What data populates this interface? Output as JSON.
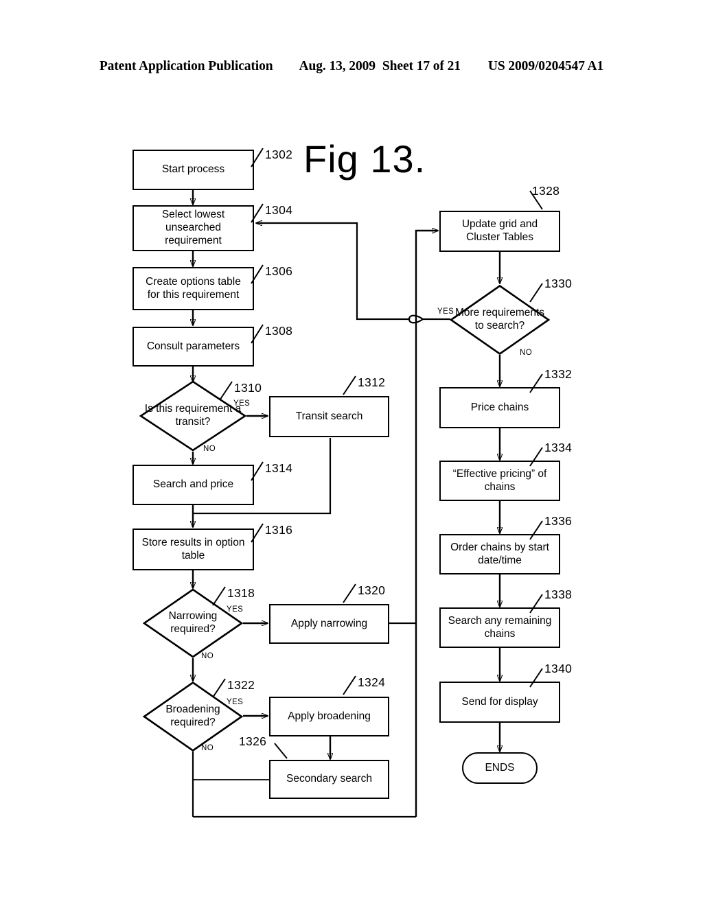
{
  "header": {
    "publication": "Patent Application Publication",
    "date": "Aug. 13, 2009",
    "sheet": "Sheet 17 of 21",
    "number": "US 2009/0204547 A1"
  },
  "figure": {
    "title": "Fig 13."
  },
  "flowchart": {
    "nodes": [
      {
        "ref": "1302",
        "shape": "box",
        "label": "Start process"
      },
      {
        "ref": "1304",
        "shape": "box",
        "label": "Select lowest unsearched requirement"
      },
      {
        "ref": "1306",
        "shape": "box",
        "label": "Create options table for this requirement"
      },
      {
        "ref": "1308",
        "shape": "box",
        "label": "Consult parameters"
      },
      {
        "ref": "1310",
        "shape": "diamond",
        "label": "Is this requirement a transit?"
      },
      {
        "ref": "1312",
        "shape": "box",
        "label": "Transit search"
      },
      {
        "ref": "1314",
        "shape": "box",
        "label": "Search and price"
      },
      {
        "ref": "1316",
        "shape": "box",
        "label": "Store results in option table"
      },
      {
        "ref": "1318",
        "shape": "diamond",
        "label": "Narrowing required?"
      },
      {
        "ref": "1320",
        "shape": "box",
        "label": "Apply narrowing"
      },
      {
        "ref": "1322",
        "shape": "diamond",
        "label": "Broadening required?"
      },
      {
        "ref": "1324",
        "shape": "box",
        "label": "Apply broadening"
      },
      {
        "ref": "1326",
        "shape": "box",
        "label": "Secondary search"
      },
      {
        "ref": "1328",
        "shape": "box",
        "label": "Update grid and Cluster Tables"
      },
      {
        "ref": "1330",
        "shape": "diamond",
        "label": "More requirements to search?"
      },
      {
        "ref": "1332",
        "shape": "box",
        "label": "Price chains"
      },
      {
        "ref": "1334",
        "shape": "box",
        "label": "“Effective pricing” of chains"
      },
      {
        "ref": "1336",
        "shape": "box",
        "label": "Order chains by start date/time"
      },
      {
        "ref": "1338",
        "shape": "box",
        "label": "Search any remaining chains"
      },
      {
        "ref": "1340",
        "shape": "box",
        "label": "Send for display"
      },
      {
        "ref": "",
        "shape": "terminator",
        "label": "ENDS"
      }
    ],
    "branch_labels": {
      "yes": "YES",
      "no": "NO"
    },
    "branches": [
      {
        "from": "1310",
        "label": "YES"
      },
      {
        "from": "1310",
        "label": "NO"
      },
      {
        "from": "1318",
        "label": "YES"
      },
      {
        "from": "1318",
        "label": "NO"
      },
      {
        "from": "1322",
        "label": "YES"
      },
      {
        "from": "1322",
        "label": "NO"
      },
      {
        "from": "1330",
        "label": "YES"
      },
      {
        "from": "1330",
        "label": "NO"
      }
    ]
  }
}
